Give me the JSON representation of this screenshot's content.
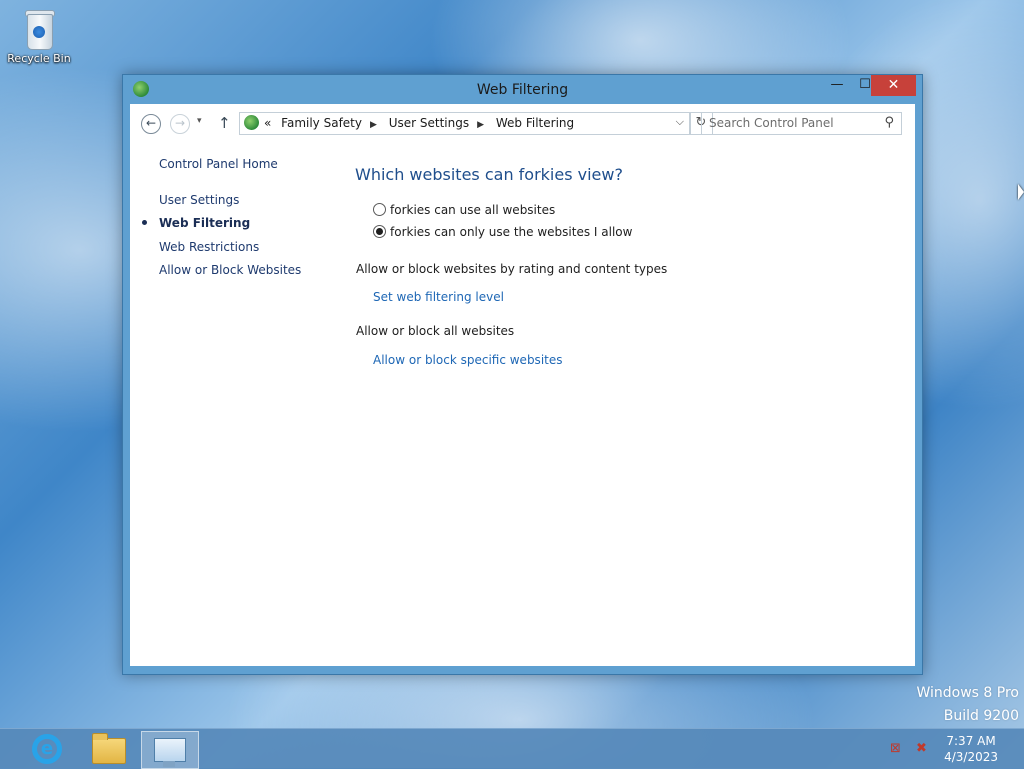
{
  "desktop": {
    "recycle_bin_label": "Recycle Bin",
    "watermark_line1": "Windows 8 Pro",
    "watermark_line2": "Build 9200"
  },
  "window": {
    "title": "Web Filtering",
    "buttons": {
      "minimize": "—",
      "maximize": "☐",
      "close": "✕"
    }
  },
  "navigation": {
    "back": "←",
    "forward": "→",
    "recent": "▾",
    "up": "↑",
    "overflow": "«",
    "breadcrumbs": [
      "Family Safety",
      "User Settings",
      "Web Filtering"
    ],
    "address_dropdown": "⌵",
    "refresh": "↻",
    "search_placeholder": "Search Control Panel"
  },
  "sidebar": {
    "home": "Control Panel Home",
    "items": [
      {
        "label": "User Settings",
        "current": false
      },
      {
        "label": "Web Filtering",
        "current": true
      },
      {
        "label": "Web Restrictions",
        "current": false
      },
      {
        "label": "Allow or Block Websites",
        "current": false
      }
    ]
  },
  "main": {
    "heading": "Which websites can forkies view?",
    "options": [
      {
        "label": "forkies can use all websites",
        "selected": false
      },
      {
        "label": "forkies can only use the websites I allow",
        "selected": true
      }
    ],
    "section1_label": "Allow or block websites by rating and content types",
    "section1_link": "Set web filtering level",
    "section2_label": "Allow or block all websites",
    "section2_link": "Allow or block specific websites"
  },
  "taskbar": {
    "clock_time": "7:37 AM",
    "clock_date": "4/3/2023",
    "items": [
      "internet-explorer",
      "file-explorer",
      "control-panel"
    ]
  }
}
